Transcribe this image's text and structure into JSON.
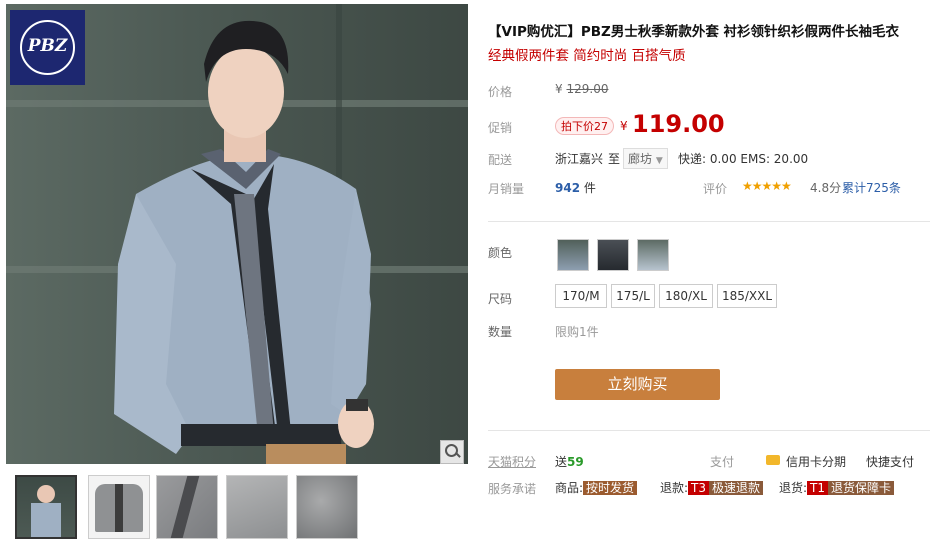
{
  "brand": {
    "logo_text": "PBZ"
  },
  "product": {
    "title": "【VIP购优汇】PBZ男士秋季新款外套 衬衫领针织衫假两件长袖毛衣",
    "subtitle": "经典假两件套 简约时尚 百搭气质"
  },
  "price": {
    "label": "价格",
    "currency": "¥",
    "original": "129.00"
  },
  "promo": {
    "label": "促销",
    "badge": "拍下价27",
    "currency": "¥",
    "value": "119.00"
  },
  "shipping": {
    "label": "配送",
    "from": "浙江嘉兴",
    "to_word": "至",
    "dest": "廊坊",
    "fee": "快递: 0.00 EMS: 20.00"
  },
  "sales": {
    "label": "月销量",
    "count": "942",
    "unit": "件",
    "rating_label": "评价",
    "stars": "★★★★★",
    "score": "4.8分",
    "total_reviews": "累计725条"
  },
  "options": {
    "color_label": "颜色",
    "size_label": "尺码",
    "sizes": [
      "170/M",
      "175/L",
      "180/XL",
      "185/XXL"
    ],
    "quantity_label": "数量",
    "quantity_limit": "限购1件"
  },
  "buy_button": "立刻购买",
  "points": {
    "label": "天猫积分",
    "prefix": "送",
    "value": "59"
  },
  "payment": {
    "label": "支付",
    "credit": "信用卡分期",
    "quick": "快捷支付"
  },
  "service": {
    "label": "服务承诺",
    "goods_label": "商品:",
    "goods_tag": "按时发货",
    "refund_label": "退款:",
    "refund_code": "T3",
    "refund_tag": "极速退款",
    "return_label": "退货:",
    "return_code": "T1",
    "return_tag": "退货保障卡"
  },
  "colors": {
    "price_red": "#c40000",
    "buy_button": "#c87f3d",
    "logo_bg": "#1d2770"
  },
  "icons": [
    "zoom-icon",
    "star-icon",
    "credit-card-icon"
  ]
}
